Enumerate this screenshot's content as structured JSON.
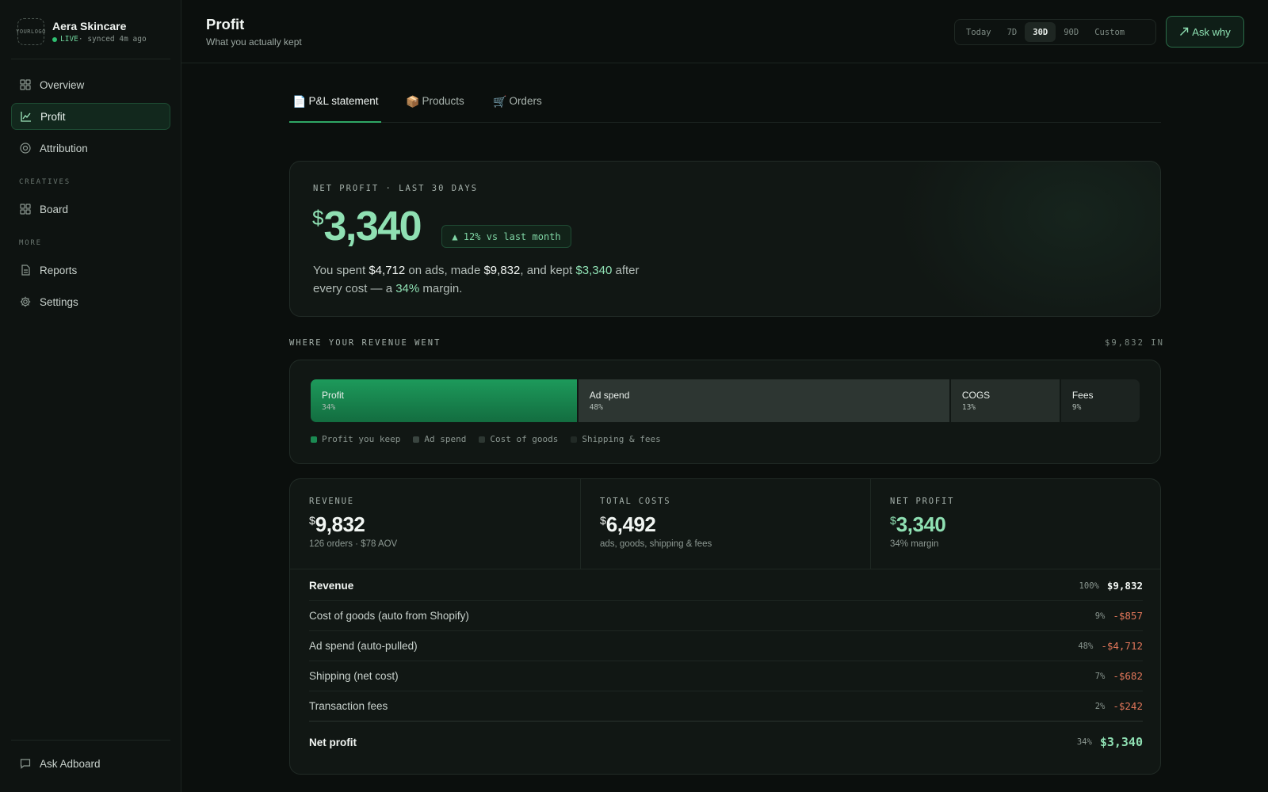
{
  "brand": {
    "logo_text_line1": "YOUR",
    "logo_text_line2": "LOGO",
    "name": "Aera Skincare",
    "status_live": "LIVE",
    "status_sync": " · synced 4m ago"
  },
  "sidebar": {
    "items": [
      {
        "label": "Overview",
        "icon": "grid-icon"
      },
      {
        "label": "Profit",
        "icon": "line-chart-icon",
        "active": true
      },
      {
        "label": "Attribution",
        "icon": "target-icon"
      }
    ],
    "section_creatives": "CREATIVES",
    "creatives_items": [
      {
        "label": "Board",
        "icon": "grid-icon"
      }
    ],
    "section_more": "MORE",
    "more_items": [
      {
        "label": "Reports",
        "icon": "document-icon"
      },
      {
        "label": "Settings",
        "icon": "gear-icon"
      }
    ],
    "bottom_item": {
      "label": "Ask Adboard",
      "icon": "chat-icon"
    }
  },
  "header": {
    "title": "Profit",
    "subtitle": "What you actually kept",
    "ranges": [
      "Today",
      "7D",
      "30D",
      "90D",
      "Custom"
    ],
    "active_range": "30D",
    "ask_button": "Ask why"
  },
  "tabs": [
    {
      "emoji": "📄",
      "label": "P&L statement",
      "active": true
    },
    {
      "emoji": "📦",
      "label": "Products"
    },
    {
      "emoji": "🛒",
      "label": "Orders"
    }
  ],
  "hero": {
    "label": "NET PROFIT · LAST 30 DAYS",
    "currency": "$",
    "value": "3,340",
    "badge": "▲ 12% vs last month",
    "sentence": {
      "p1": "You spent ",
      "ad_spend": "$4,712",
      "p2": " on ads, made ",
      "revenue": "$9,832",
      "p3": ", and kept ",
      "kept": "$3,340",
      "p4": " after every cost — a ",
      "margin": "34%",
      "p5": " margin."
    }
  },
  "split": {
    "title": "WHERE YOUR REVENUE WENT",
    "total": "$9,832 IN",
    "segments": [
      {
        "name": "Profit",
        "pct_label": "34%",
        "share": 0.34,
        "color": "#1b8a52"
      },
      {
        "name": "Ad spend",
        "pct_label": "48%",
        "share": 0.48,
        "color": "#2d3632"
      },
      {
        "name": "COGS",
        "pct_label": "13%",
        "share": 0.13,
        "color": "#262e2a"
      },
      {
        "name": "Fees",
        "pct_label": "9%",
        "share": 0.09,
        "color": "#1c2320"
      }
    ],
    "legend": [
      {
        "label": "Profit you keep",
        "color": "#1b8a52"
      },
      {
        "label": "Ad spend",
        "color": "#3a4540"
      },
      {
        "label": "Cost of goods",
        "color": "#2e3833"
      },
      {
        "label": "Shipping & fees",
        "color": "#222a26"
      }
    ]
  },
  "stats": [
    {
      "label": "REVENUE",
      "currency": "$",
      "value": "9,832",
      "sub": "126 orders · $78 AOV"
    },
    {
      "label": "TOTAL COSTS",
      "currency": "$",
      "value": "6,492",
      "sub": "ads, goods, shipping & fees"
    },
    {
      "label": "NET PROFIT",
      "currency": "$",
      "value": "3,340",
      "sub": "34% margin"
    }
  ],
  "pl_rows": [
    {
      "label": "Revenue",
      "pct": "100%",
      "value": "$9,832"
    },
    {
      "label": "Cost of goods (auto from Shopify)",
      "pct": "9%",
      "value": "-$857"
    },
    {
      "label": "Ad spend (auto-pulled)",
      "pct": "48%",
      "value": "-$4,712"
    },
    {
      "label": "Shipping (net cost)",
      "pct": "7%",
      "value": "-$682"
    },
    {
      "label": "Transaction fees",
      "pct": "2%",
      "value": "-$242"
    },
    {
      "label": "Net profit",
      "pct": "34%",
      "value": "$3,340"
    }
  ],
  "colors": {
    "accent": "#8fe0b3",
    "accent_dark": "#1b8a52",
    "negative": "#e0765a",
    "background": "#0b0f0d"
  }
}
